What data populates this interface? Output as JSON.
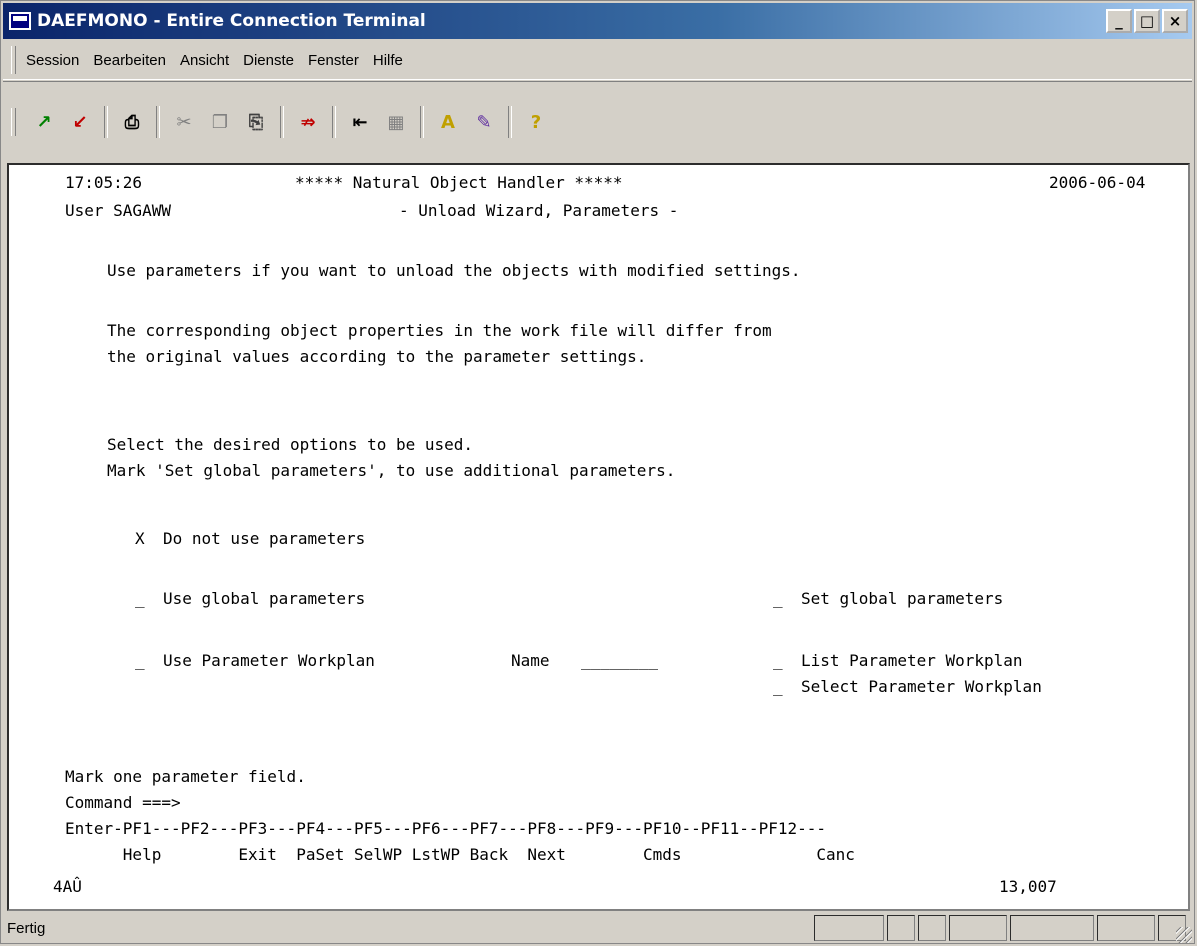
{
  "window": {
    "title": "DAEFMONO - Entire Connection Terminal",
    "buttons": {
      "minimize": "_",
      "maximize": "□",
      "close": "×"
    }
  },
  "menu": [
    "Session",
    "Bearbeiten",
    "Ansicht",
    "Dienste",
    "Fenster",
    "Hilfe"
  ],
  "toolbar_icons": [
    "connect-icon",
    "disconnect-icon",
    "print-icon",
    "cut-icon",
    "copy-icon",
    "paste-icon",
    "transfer-icon",
    "send-icon",
    "receive-icon",
    "font-icon",
    "color-icon",
    "help-icon"
  ],
  "terminal": {
    "time": "17:05:26",
    "header": "***** Natural Object Handler *****",
    "date": "2006-06-04",
    "user": "User SAGAWW",
    "subtitle": "- Unload Wizard, Parameters -",
    "intro": "Use parameters if you want to unload the objects with modified settings.",
    "desc1": "The corresponding object properties in the work file will differ from",
    "desc2": "the original values according to the parameter settings.",
    "instr1": "Select the desired options to be used.",
    "instr2": "Mark 'Set global parameters', to use additional parameters.",
    "options": {
      "do_not_use": {
        "mark": "X",
        "label": "Do not use parameters"
      },
      "use_global": {
        "mark": "_",
        "label": "Use global parameters"
      },
      "set_global": {
        "mark": "_",
        "label": "Set global parameters"
      },
      "use_workplan": {
        "mark": "_",
        "label": "Use Parameter Workplan"
      },
      "name_label": "Name",
      "name_value": "________",
      "list_workplan": {
        "mark": "_",
        "label": "List Parameter Workplan"
      },
      "select_workplan": {
        "mark": "_",
        "label": "Select Parameter Workplan"
      }
    },
    "message": "Mark one parameter field.",
    "command": "Command ===>",
    "pf_line": "Enter-PF1---PF2---PF3---PF4---PF5---PF6---PF7---PF8---PF9---PF10--PF11--PF12---",
    "pf_labels": "      Help        Exit  PaSet SelWP LstWP Back  Next        Cmds              Canc",
    "status_left": "4AÛ",
    "status_right": "13,007"
  },
  "status": {
    "text": "Fertig"
  }
}
